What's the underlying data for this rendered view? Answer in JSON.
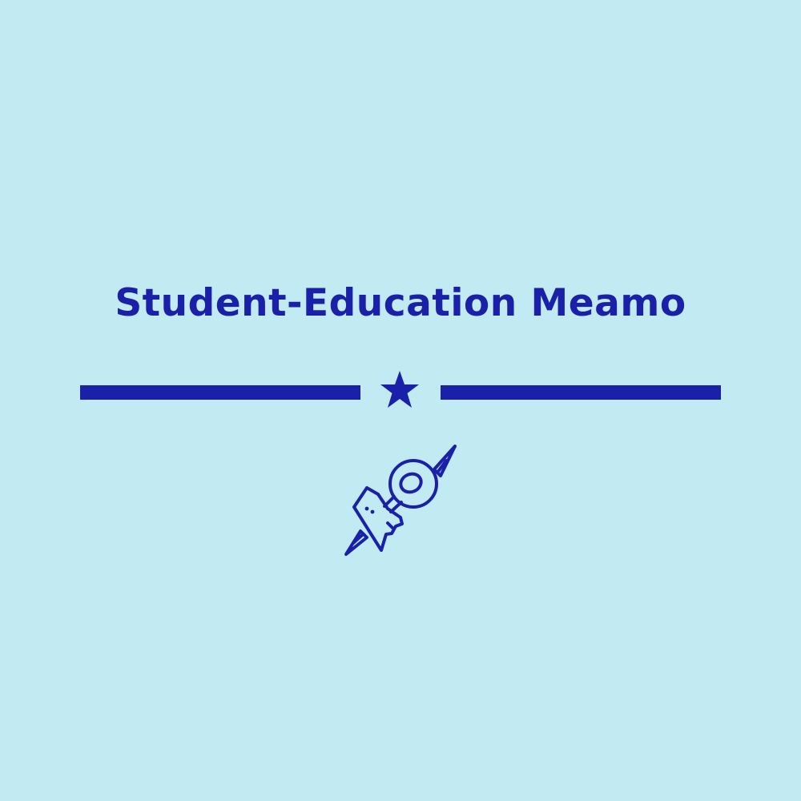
{
  "title": "Student-Education Meamo",
  "colors": {
    "background": "#c2eaf2",
    "accent": "#1a21a8"
  },
  "icons": {
    "divider_icon": "star-icon",
    "emblem_icon": "pen-key-emblem-icon"
  }
}
